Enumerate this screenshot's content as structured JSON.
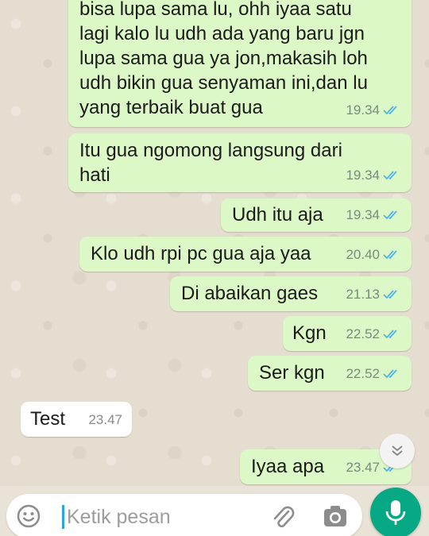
{
  "messages": [
    {
      "dir": "out",
      "text": "bisa lupa sama lu, ohh iyaa satu\nlagi kalo lu udh ada yang baru jgn\nlupa sama gua ya jon,makasih loh\nudh bikin gua senyaman ini,dan lu\nyang terbaik buat gua",
      "time": "19.34",
      "read": true
    },
    {
      "dir": "out",
      "text": "Itu gua ngomong langsung dari\nhati",
      "time": "19.34",
      "read": true
    },
    {
      "dir": "out",
      "text": "Udh itu aja",
      "time": "19.34",
      "read": true
    },
    {
      "dir": "out",
      "text": "Klo udh rpi pc gua aja yaa",
      "time": "20.40",
      "read": true
    },
    {
      "dir": "out",
      "text": "Di abaikan gaes",
      "time": "21.13",
      "read": true
    },
    {
      "dir": "out",
      "text": "Kgn",
      "time": "22.52",
      "read": true
    },
    {
      "dir": "out",
      "text": "Ser kgn",
      "time": "22.52",
      "read": true
    },
    {
      "dir": "in",
      "text": "Test",
      "time": "23.47"
    },
    {
      "dir": "out",
      "text": "Iyaa apa",
      "time": "23.47",
      "read": true
    }
  ],
  "composer": {
    "placeholder": "Ketik pesan"
  },
  "colors": {
    "outgoing_bubble": "#dcf8c6",
    "incoming_bubble": "#ffffff",
    "read_ticks": "#4fb3e8",
    "mic_button": "#07a884"
  },
  "icons": [
    "emoji-icon",
    "attach-icon",
    "camera-icon",
    "mic-icon",
    "scroll-down-icon",
    "double-tick-icon"
  ]
}
